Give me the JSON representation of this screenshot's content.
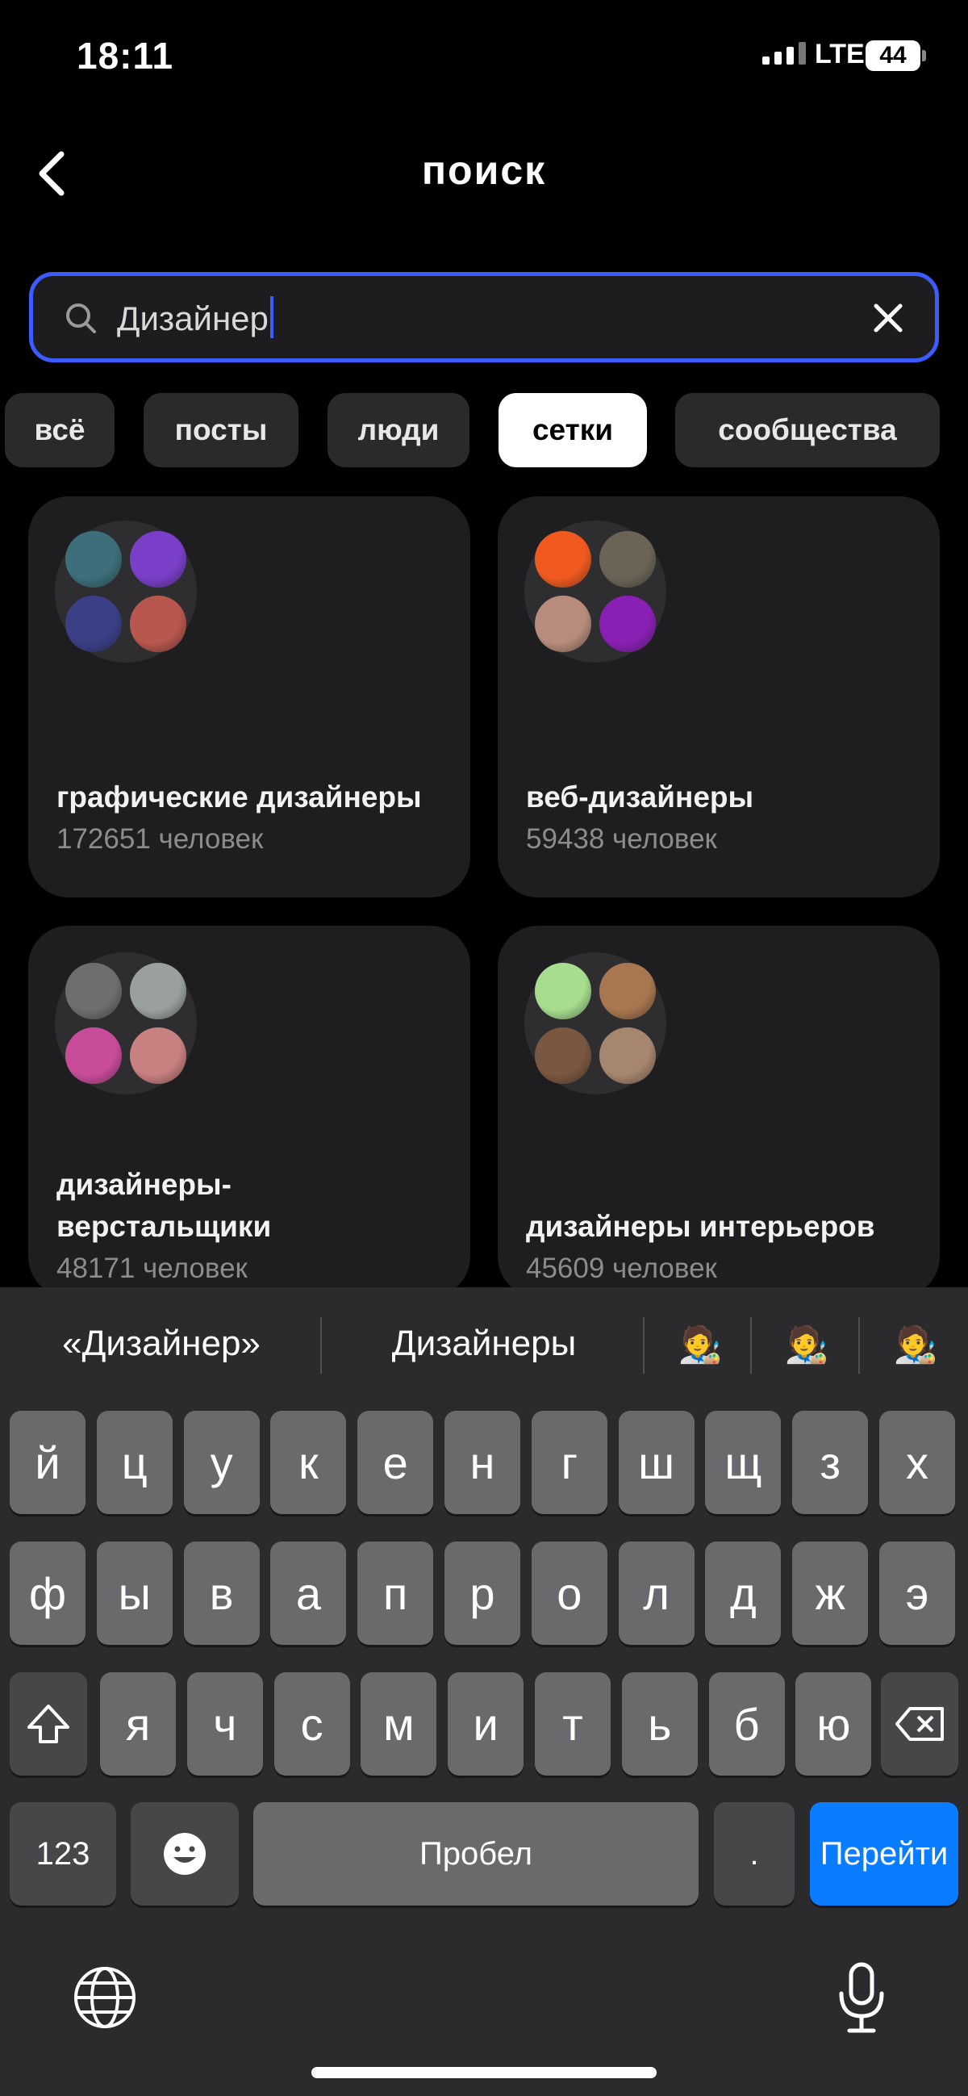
{
  "status": {
    "time": "18:11",
    "network": "LTE",
    "battery": "44"
  },
  "header": {
    "title": "поиск"
  },
  "search": {
    "value": "Дизайнер"
  },
  "filters": [
    {
      "label": "всё",
      "active": false
    },
    {
      "label": "посты",
      "active": false
    },
    {
      "label": "люди",
      "active": false
    },
    {
      "label": "сетки",
      "active": true
    },
    {
      "label": "сообщества",
      "active": false
    }
  ],
  "cards": [
    {
      "name": "графические дизайнеры",
      "count": "172651 человек",
      "avatars": [
        "#3c6f7a",
        "#7a3ec9",
        "#3a3f86",
        "#b8574d"
      ]
    },
    {
      "name": "веб-дизайнеры",
      "count": "59438 человек",
      "avatars": [
        "#f05a1e",
        "#6b6456",
        "#b88c7c",
        "#8a1fb5"
      ]
    },
    {
      "name": "дизайнеры-\nверстальщики",
      "name_line1": "дизайнеры-",
      "name_line2": "верстальщики",
      "count": "48171 человек",
      "avatars": [
        "#6e6e6e",
        "#9aa0a0",
        "#c94c9b",
        "#c98080"
      ]
    },
    {
      "name": "дизайнеры интерьеров",
      "count": "45609 человек",
      "avatars": [
        "#a7dd8f",
        "#a9774f",
        "#7a5740",
        "#a7866f"
      ]
    }
  ],
  "keyboard": {
    "suggestions": [
      "«Дизайнер»",
      "Дизайнеры"
    ],
    "emoji_suggestions": [
      "🧑‍🎨",
      "🧑‍🎨",
      "🧑‍🎨"
    ],
    "row1": [
      "й",
      "ц",
      "у",
      "к",
      "е",
      "н",
      "г",
      "ш",
      "щ",
      "з",
      "х"
    ],
    "row2": [
      "ф",
      "ы",
      "в",
      "а",
      "п",
      "р",
      "о",
      "л",
      "д",
      "ж",
      "э"
    ],
    "row3": [
      "я",
      "ч",
      "с",
      "м",
      "и",
      "т",
      "ь",
      "б",
      "ю"
    ],
    "numbers_label": "123",
    "space_label": "Пробел",
    "period_label": ".",
    "go_label": "Перейти"
  },
  "colors": {
    "accent": "#3D5CFF",
    "go_key": "#0A7CFF",
    "card_bg": "#1E1E20"
  }
}
